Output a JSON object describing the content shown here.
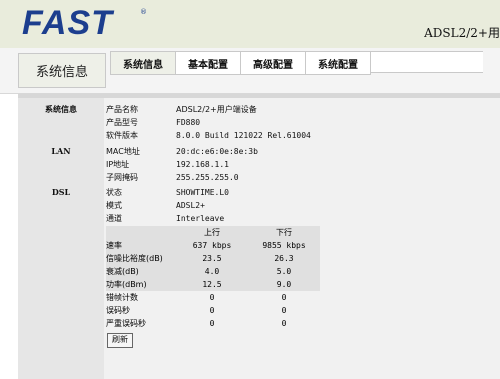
{
  "header": {
    "logo": "FAST",
    "logo_reg": "®",
    "model_title": "ADSL2/2+用"
  },
  "section_title": "系统信息",
  "tabs": [
    {
      "label": "系统信息"
    },
    {
      "label": "基本配置"
    },
    {
      "label": "高级配置"
    },
    {
      "label": "系统配置"
    }
  ],
  "sections": {
    "system": "系统信息",
    "lan": "LAN",
    "dsl": "DSL"
  },
  "system_info": [
    {
      "label": "产品名称",
      "value": "ADSL2/2+用户端设备"
    },
    {
      "label": "产品型号",
      "value": "FD880"
    },
    {
      "label": "软件版本",
      "value": "8.0.0 Build 121022 Rel.61004"
    }
  ],
  "lan_info": [
    {
      "label": "MAC地址",
      "value": "20:dc:e6:0e:8e:3b"
    },
    {
      "label": "IP地址",
      "value": "192.168.1.1"
    },
    {
      "label": "子网掩码",
      "value": "255.255.255.0"
    }
  ],
  "dsl_info": [
    {
      "label": "状态",
      "value": "SHOWTIME.L0"
    },
    {
      "label": "模式",
      "value": "ADSL2+"
    },
    {
      "label": "通道",
      "value": "Interleave"
    }
  ],
  "dsl_stats": {
    "headers": [
      "",
      "上行",
      "下行"
    ],
    "rows": [
      [
        "速率",
        "637 kbps",
        "9855 kbps"
      ],
      [
        "信噪比裕度(dB)",
        "23.5",
        "26.3"
      ],
      [
        "衰减(dB)",
        "4.0",
        "5.0"
      ],
      [
        "功率(dBm)",
        "12.5",
        "9.0"
      ],
      [
        "错帧计数",
        "0",
        "0"
      ],
      [
        "误码秒",
        "0",
        "0"
      ],
      [
        "严重误码秒",
        "0",
        "0"
      ]
    ]
  },
  "refresh_label": "刷新"
}
